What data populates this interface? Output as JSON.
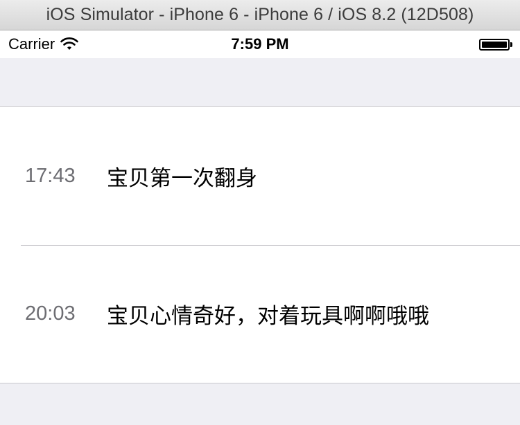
{
  "window": {
    "title": "iOS Simulator - iPhone 6 - iPhone 6 / iOS 8.2 (12D508)"
  },
  "status_bar": {
    "carrier": "Carrier",
    "wifi_icon": "wifi-icon",
    "time": "7:59 PM",
    "battery_icon": "battery-full-icon",
    "battery_level": 1.0
  },
  "table": {
    "rows": [
      {
        "time": "17:43",
        "text": "宝贝第一次翻身"
      },
      {
        "time": "20:03",
        "text": "宝贝心情奇好，对着玩具啊啊哦哦"
      }
    ]
  },
  "colors": {
    "group_background": "#efeff4",
    "separator": "#c8c7cc",
    "secondary_text": "#6d6d72"
  }
}
